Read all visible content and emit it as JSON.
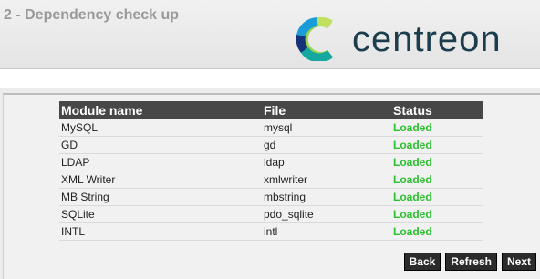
{
  "header": {
    "step_title": "2 - Dependency check up",
    "logo_text": "centreon"
  },
  "table": {
    "columns": [
      "Module name",
      "File",
      "Status"
    ],
    "rows": [
      {
        "module": "MySQL",
        "file": "mysql",
        "status": "Loaded"
      },
      {
        "module": "GD",
        "file": "gd",
        "status": "Loaded"
      },
      {
        "module": "LDAP",
        "file": "ldap",
        "status": "Loaded"
      },
      {
        "module": "XML Writer",
        "file": "xmlwriter",
        "status": "Loaded"
      },
      {
        "module": "MB String",
        "file": "mbstring",
        "status": "Loaded"
      },
      {
        "module": "SQLite",
        "file": "pdo_sqlite",
        "status": "Loaded"
      },
      {
        "module": "INTL",
        "file": "intl",
        "status": "Loaded"
      }
    ]
  },
  "buttons": {
    "back": "Back",
    "refresh": "Refresh",
    "next": "Next"
  },
  "colors": {
    "status_loaded": "#2dbf30",
    "header_bar": "#474747",
    "logo_text": "#1c3d4d"
  }
}
